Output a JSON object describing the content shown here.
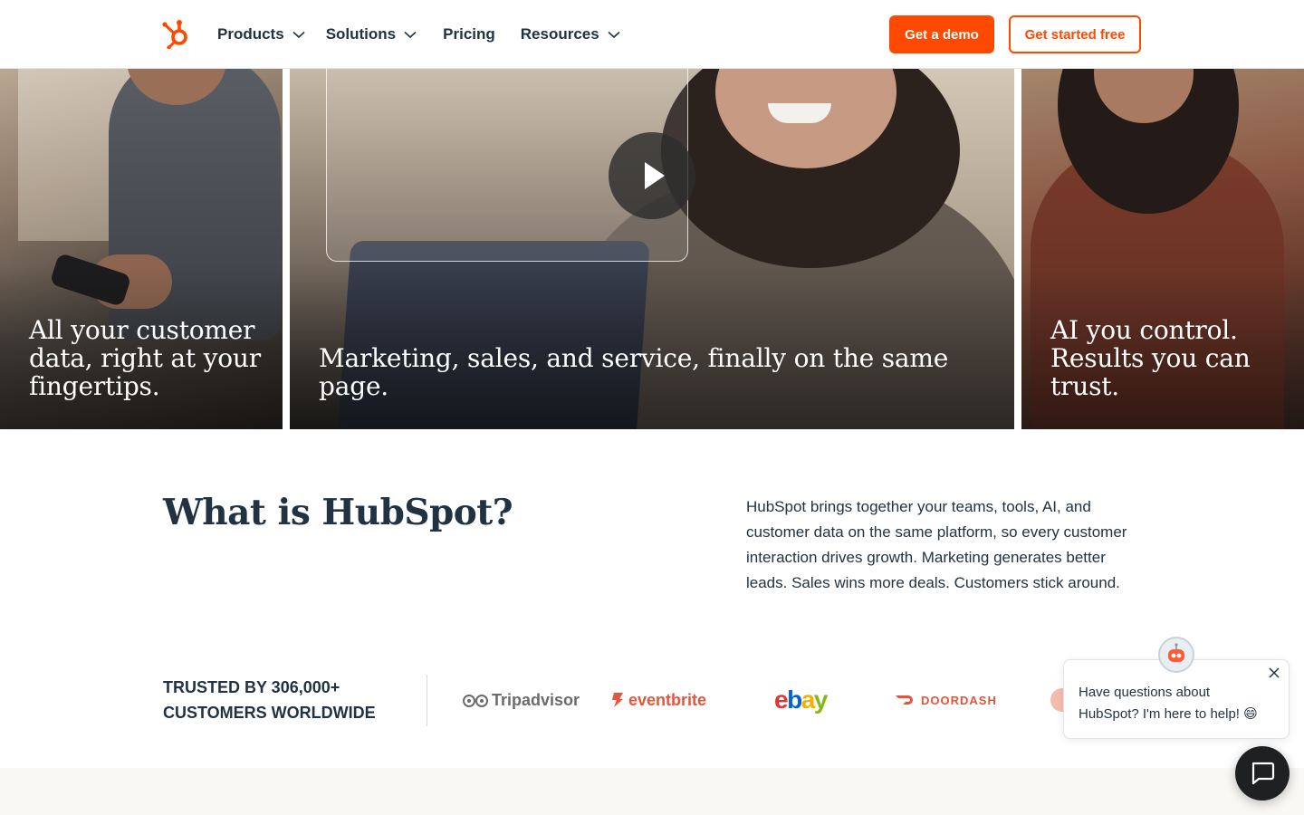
{
  "header": {
    "logo_icon": "hubspot-sprocket-icon",
    "nav": [
      {
        "label": "Products",
        "has_dropdown": true
      },
      {
        "label": "Solutions",
        "has_dropdown": true
      },
      {
        "label": "Pricing",
        "has_dropdown": false
      },
      {
        "label": "Resources",
        "has_dropdown": true
      }
    ],
    "demo_label": "Get a demo",
    "free_label": "Get started free"
  },
  "hero": {
    "cards": [
      {
        "caption": "All your customer data, right at your fingertips."
      },
      {
        "caption": "Marketing, sales, and service, finally on the same page.",
        "play_icon": "play-icon"
      },
      {
        "caption": "AI you control. Results you can trust."
      }
    ]
  },
  "about": {
    "title": "What is HubSpot?",
    "body": "HubSpot brings together your teams, tools, AI, and customer data on the same platform, so every customer interaction drives growth. Marketing generates better leads. Sales wins more deals. Customers stick around."
  },
  "trusted": {
    "label": "TRUSTED BY 306,000+ CUSTOMERS WORLDWIDE",
    "logos": [
      {
        "name": "Tripadvisor",
        "text": "Tripadvisor"
      },
      {
        "name": "eventbrite",
        "text": "eventbrite"
      },
      {
        "name": "ebay",
        "letters": [
          "e",
          "b",
          "a",
          "y"
        ],
        "colors": [
          "#e53238",
          "#0064d2",
          "#f5af02",
          "#86b817"
        ]
      },
      {
        "name": "DoorDash",
        "text": "DOORDASH"
      }
    ]
  },
  "chat": {
    "message": "Have questions about HubSpot? I'm here to help! 😄",
    "close_icon": "close-icon",
    "avatar_icon": "robot-avatar-icon",
    "launcher_icon": "chat-icon"
  },
  "colors": {
    "brand_orange": "#ff4800",
    "text_dark": "#213343"
  }
}
